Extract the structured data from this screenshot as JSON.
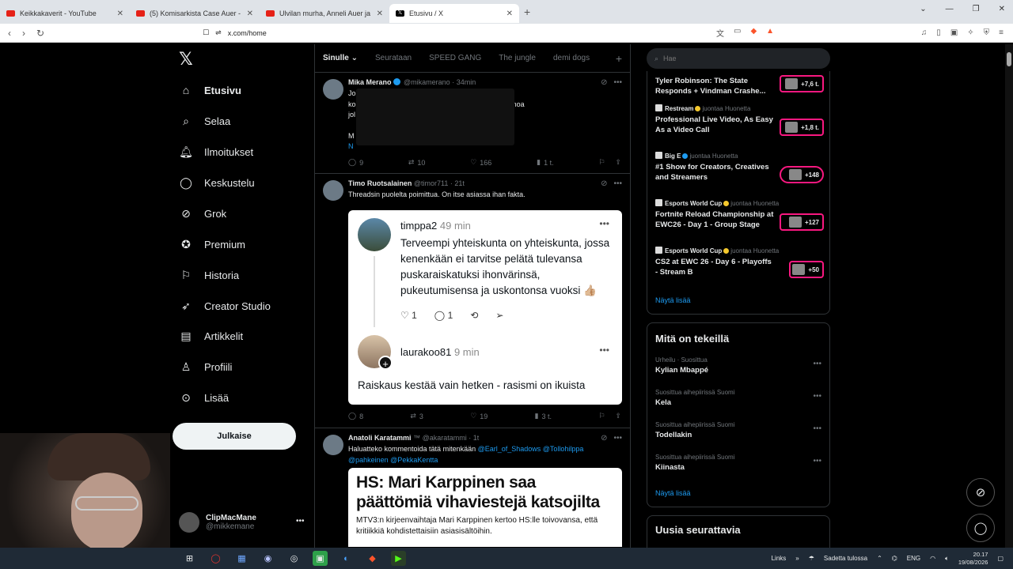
{
  "browser": {
    "tabs": [
      {
        "title": "Keikkakaverit - YouTube",
        "active": false
      },
      {
        "title": "(5) Komisarkista Case Auer - YouTube",
        "active": false
      },
      {
        "title": "Ulvilan murha, Anneli Auer ja tuore l",
        "active": false
      },
      {
        "title": "Etusivu / X",
        "active": true
      }
    ],
    "url": "x.com/home"
  },
  "sidebar": {
    "items": [
      {
        "label": "Etusivu",
        "icon": "home-icon"
      },
      {
        "label": "Selaa",
        "icon": "search-icon"
      },
      {
        "label": "Ilmoitukset",
        "icon": "bell-icon"
      },
      {
        "label": "Keskustelu",
        "icon": "chat-icon"
      },
      {
        "label": "Grok",
        "icon": "grok-icon"
      },
      {
        "label": "Premium",
        "icon": "premium-icon"
      },
      {
        "label": "Historia",
        "icon": "bookmark-icon"
      },
      {
        "label": "Creator Studio",
        "icon": "rocket-icon"
      },
      {
        "label": "Artikkelit",
        "icon": "articles-icon"
      },
      {
        "label": "Profiili",
        "icon": "person-icon"
      },
      {
        "label": "Lisää",
        "icon": "more-circle-icon"
      }
    ],
    "post_label": "Julkaise",
    "account": {
      "name": "ClipMacMane",
      "handle": "@mikkemane"
    }
  },
  "feed_tabs": [
    "Sinulle",
    "Seurataan",
    "SPEED GANG",
    "The jungle",
    "demi dogs"
  ],
  "tweets": [
    {
      "name": "Mika Merano",
      "handle": "@mikamerano",
      "time": "· 34min",
      "lines": [
        "Joku ....................................ttien mukaan, mutta jos",
        "ko .................................................an laita on), niin ainoa",
        "jol ................................................. Perussuomalaiset.",
        "",
        "M ...................................................ppia, suuria",
        "N"
      ],
      "replies": "9",
      "reposts": "10",
      "likes": "166",
      "views": "1 t."
    },
    {
      "name": "Timo Ruotsalainen",
      "handle": "@timor711",
      "time": "· 21t",
      "text": "Threadsin puolelta poimittua. On itse asiassa ihan fakta.",
      "embed": {
        "user1": "timppa2",
        "time1": "49 min",
        "text1": "Terveempi yhteiskunta on yhteiskunta, jossa kenenkään ei tarvitse pelätä tulevansa puskaraiskatuksi ihonvärinsä, pukeutumisensa ja uskontonsa vuoksi 👍🏼",
        "likes1": "1",
        "comments1": "1",
        "user2": "laurakoo81",
        "time2": "9 min",
        "text2": "Raiskaus kestää vain hetken - rasismi on ikuista"
      },
      "replies": "8",
      "reposts": "3",
      "likes": "19",
      "views": "3 t."
    },
    {
      "name": "Anatoli Karatammi",
      "handle": "@akaratammi",
      "time": "· 1t",
      "text": "Haluatteko kommentoida tätä mitenkään ",
      "mentions": "@Earl_of_Shadows @Tollohilppa",
      "mentions2": "@pahkeinen @PekkaKentta",
      "hs_headline": "HS: Mari Karppinen saa päättömiä vihaviestejä katsojilta",
      "hs_sub": "MTV3:n kirjeenvaihtaja Mari Karppinen kertoo HS:lle toivovansa, että kritiikkiä kohdistettaisiin asiasisältöihin."
    }
  ],
  "search": {
    "placeholder": "Hae"
  },
  "live": [
    {
      "by": "",
      "title": "Tyler Robinson: The State Responds + Vindman Crashe...",
      "count": "+7,6 t."
    },
    {
      "by": "Restream",
      "suffix": "juontaa Huonetta",
      "title": "Professional Live Video, As Easy As a Video Call",
      "count": "+1,8 t."
    },
    {
      "by": "Big E",
      "suffix": "juontaa Huonetta",
      "title": "#1 Show for Creators, Creatives and Streamers",
      "count": "+148"
    },
    {
      "by": "Esports World Cup",
      "suffix": "juontaa Huonetta",
      "title": "Fortnite Reload Championship at EWC26 - Day 1 - Group Stage",
      "count": "+127"
    },
    {
      "by": "Esports World Cup",
      "suffix": "juontaa Huonetta",
      "title": "CS2 at EWC 26 - Day 6 - Playoffs - Stream B",
      "count": "+50"
    }
  ],
  "show_more": "Näytä lisää",
  "trending": {
    "title": "Mitä on tekeillä",
    "items": [
      {
        "context": "Urheilu · Suosittua",
        "name": "Kylian Mbappé"
      },
      {
        "context": "Suosittua aihepiirissä Suomi",
        "name": "Kela"
      },
      {
        "context": "Suosittua aihepiirissä Suomi",
        "name": "Todellakin"
      },
      {
        "context": "Suosittua aihepiirissä Suomi",
        "name": "Kiinasta"
      }
    ],
    "show_more": "Näytä lisää"
  },
  "follow": {
    "title": "Uusia seurattavia"
  },
  "taskbar": {
    "links": "Links",
    "weather": "Sadetta tulossa",
    "lang": "ENG",
    "time": "20.17",
    "date": "19/08/2026"
  },
  "colors": {
    "accent": "#1d9bf0",
    "live_border": "#f91880",
    "background": "#000000"
  }
}
